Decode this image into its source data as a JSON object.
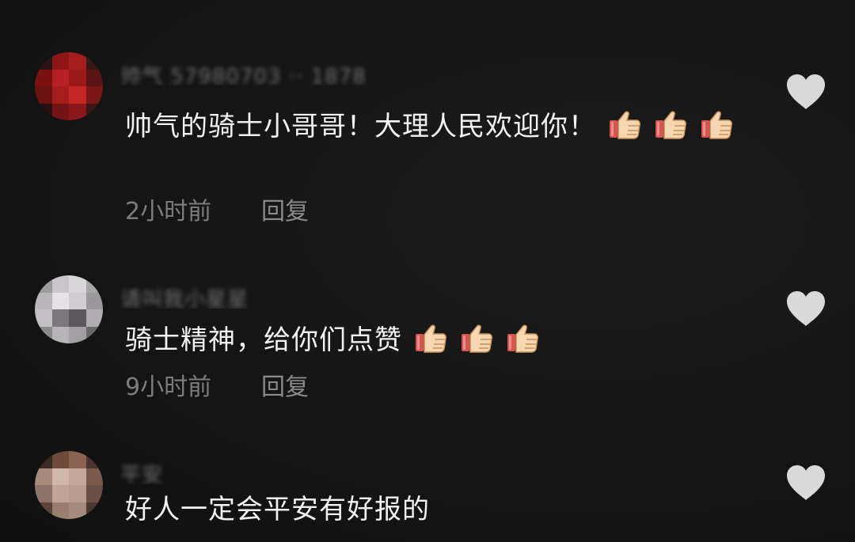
{
  "comments": [
    {
      "username": "帅气 57980703 ·· 1878",
      "text": "帅气的骑士小哥哥！大理人民欢迎你！",
      "thumbs": 3,
      "time": "2小时前",
      "reply": "回复",
      "avatar_colors": [
        "#2a1414",
        "#8e1616",
        "#a31d1d",
        "#3a1616",
        "#7a1212",
        "#b52020",
        "#9a1a1a",
        "#5a1414",
        "#6b1212",
        "#a51c1c",
        "#c42525",
        "#7c1515",
        "#2a1111",
        "#751414",
        "#8a1818",
        "#3a1515"
      ]
    },
    {
      "username": "请叫我小星星",
      "text": "骑士精神，给你们点赞",
      "thumbs": 3,
      "time": "9小时前",
      "reply": "回复",
      "avatar_colors": [
        "#9c9a9c",
        "#c8c6c8",
        "#d8d6d8",
        "#a8a6a8",
        "#b8b6b8",
        "#e4e2e4",
        "#cfcdcf",
        "#9a989a",
        "#c2c0c2",
        "#7a787a",
        "#5a585a",
        "#b0aeb0",
        "#8c8a8c",
        "#b6b4b6",
        "#a29fa2",
        "#6a686a"
      ]
    },
    {
      "username": "平安",
      "text": "好人一定会平安有好报的",
      "thumbs": 0,
      "time": "",
      "reply": "",
      "avatar_colors": [
        "#3a2a24",
        "#6e4a3a",
        "#8a6250",
        "#4a342c",
        "#a88a7a",
        "#d0b8a8",
        "#c4a898",
        "#7a5a4a",
        "#8e7468",
        "#c0a494",
        "#b89c8c",
        "#6a5044",
        "#5a443c",
        "#9a7e70",
        "#a48a7c",
        "#4a3a34"
      ]
    }
  ],
  "colors": {
    "background": "#161616",
    "text": "#f2f2f2",
    "meta": "#7d7d7d",
    "like_icon": "#d9d9d9",
    "thumb_fill": "#f7d7b1",
    "thumb_cuff": "#d9534f"
  },
  "icons": {
    "like": "heart-icon",
    "thumb": "thumbs-up-emoji"
  }
}
